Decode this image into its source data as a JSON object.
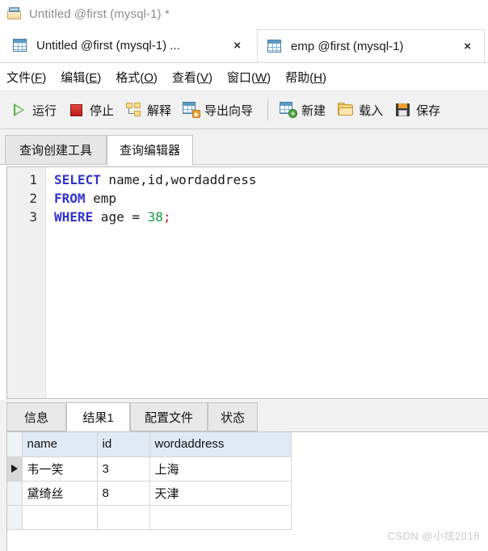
{
  "window": {
    "title": "Untitled @first (mysql-1) *",
    "icon": "query-file-icon"
  },
  "doc_tabs": [
    {
      "label": "Untitled @first (mysql-1) ...",
      "close": "×",
      "active": false,
      "icon": "query-grid-icon"
    },
    {
      "label": "emp @first (mysql-1)",
      "close": "×",
      "active": true,
      "icon": "table-grid-icon"
    }
  ],
  "menubar": {
    "items": [
      {
        "text": "文件",
        "accel": "F"
      },
      {
        "text": "编辑",
        "accel": "E"
      },
      {
        "text": "格式",
        "accel": "O"
      },
      {
        "text": "查看",
        "accel": "V"
      },
      {
        "text": "窗口",
        "accel": "W"
      },
      {
        "text": "帮助",
        "accel": "H"
      }
    ]
  },
  "toolbar": {
    "run_label": "运行",
    "stop_label": "停止",
    "explain_label": "解释",
    "export_label": "导出向导",
    "new_label": "新建",
    "load_label": "载入",
    "save_label": "保存"
  },
  "query_tabs": [
    {
      "label": "查询创建工具",
      "active": false
    },
    {
      "label": "查询编辑器",
      "active": true
    }
  ],
  "editor": {
    "line_numbers": [
      "1",
      "2",
      "3"
    ],
    "lines": [
      {
        "keyword": "SELECT",
        "rest": " name,id,wordaddress"
      },
      {
        "keyword": "FROM",
        "rest": " emp"
      },
      {
        "keyword": "WHERE",
        "rest": " age = ",
        "number": "38",
        "terminator": ";"
      }
    ],
    "sql_text": "SELECT name,id,wordaddress\nFROM emp\nWHERE age = 38;"
  },
  "result_tabs": [
    {
      "label": "信息",
      "active": false
    },
    {
      "label": "结果1",
      "active": true
    },
    {
      "label": "配置文件",
      "active": false
    },
    {
      "label": "状态",
      "active": false
    }
  ],
  "result_grid": {
    "columns": [
      "name",
      "id",
      "wordaddress"
    ],
    "rows": [
      {
        "selected": true,
        "name": "韦一笑",
        "id": "3",
        "wordaddress": "上海"
      },
      {
        "selected": false,
        "name": "黛绮丝",
        "id": "8",
        "wordaddress": "天津"
      }
    ]
  },
  "watermark": "CSDN @小炫2018",
  "colors": {
    "keyword": "#3333cc",
    "number": "#139a43",
    "punctuation": "#d02020",
    "toolbar_bg": "#f1f1f1",
    "grid_header_bg": "#dfeaf5",
    "title_text": "#8d8d8d"
  }
}
